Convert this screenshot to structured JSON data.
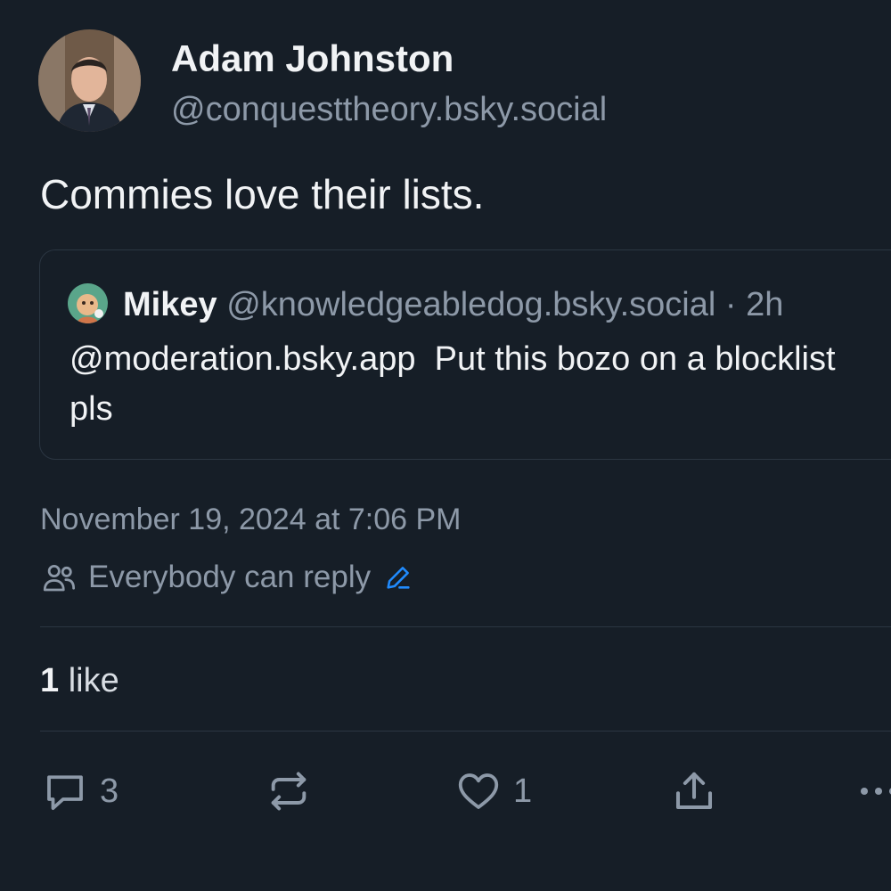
{
  "post": {
    "author": {
      "display_name": "Adam Johnston",
      "handle": "@conquesttheory.bsky.social"
    },
    "text": "Commies love their lists.",
    "timestamp": "November 19, 2024 at 7:06 PM",
    "reply_setting": "Everybody can reply",
    "likes_count": "1",
    "likes_word": "like"
  },
  "quote": {
    "display_name": "Mikey",
    "handle": "@knowledgeabledog.bsky.social",
    "separator": "·",
    "age": "2h",
    "text": "@moderation.bsky.app  Put this bozo on a blocklist pls"
  },
  "actions": {
    "reply_count": "3",
    "like_count": "1"
  },
  "icons": [
    "avatar",
    "people-icon",
    "pencil-icon",
    "reply-icon",
    "repost-icon",
    "heart-icon",
    "share-icon",
    "more-icon"
  ],
  "colors": {
    "background": "#161e27",
    "text": "#f1f3f5",
    "muted": "#8d99a8",
    "accent": "#208bfe",
    "border": "#2b3642"
  }
}
